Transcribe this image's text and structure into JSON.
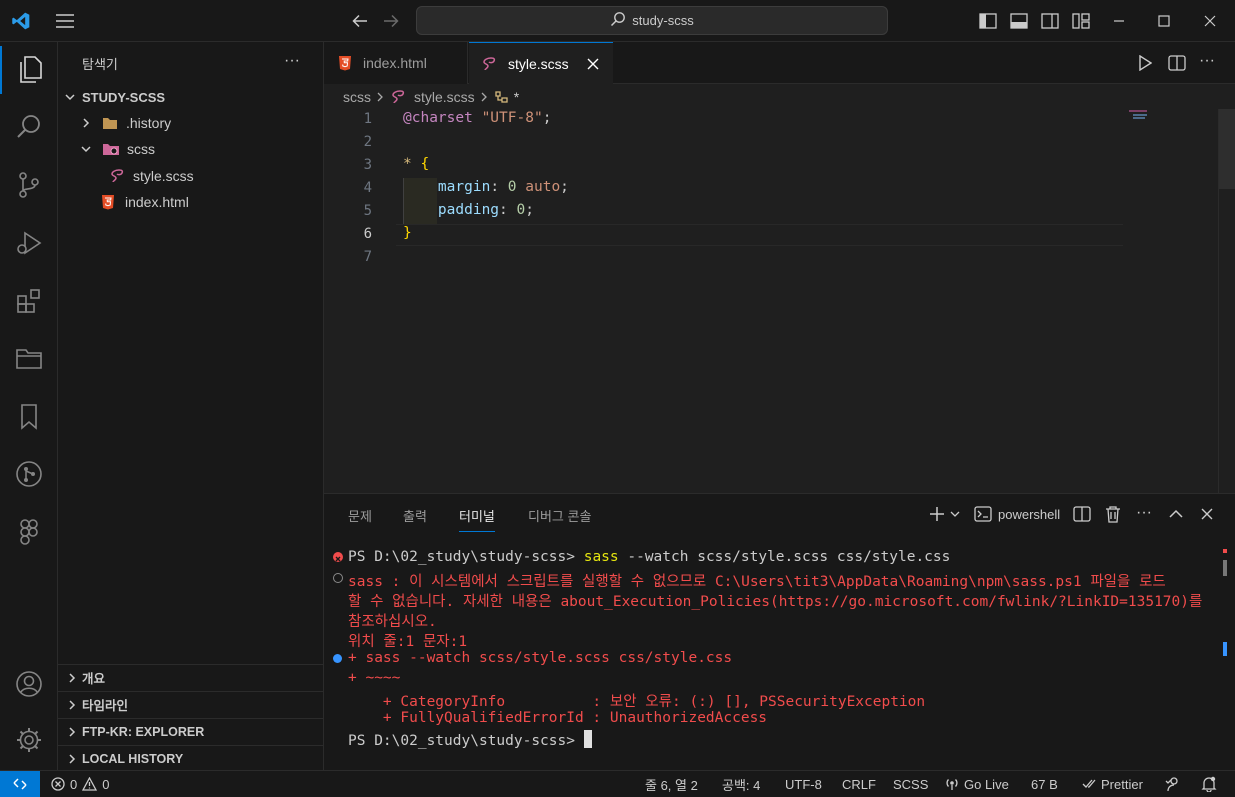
{
  "titlebar": {
    "search_text": "study-scss"
  },
  "sidebar": {
    "title": "탐색기",
    "more": "···",
    "root": "STUDY-SCSS",
    "items": [
      {
        "label": ".history"
      },
      {
        "label": "scss"
      },
      {
        "label": "style.scss"
      },
      {
        "label": "index.html"
      }
    ],
    "sections": [
      {
        "label": "개요"
      },
      {
        "label": "타임라인"
      },
      {
        "label": "FTP-KR: EXPLORER"
      },
      {
        "label": "LOCAL HISTORY"
      }
    ]
  },
  "tabs": [
    {
      "label": "index.html"
    },
    {
      "label": "style.scss"
    }
  ],
  "breadcrumb": {
    "folder": "scss",
    "file": "style.scss",
    "symbol": "*"
  },
  "editor": {
    "line_numbers": [
      "1",
      "2",
      "3",
      "4",
      "5",
      "6",
      "7"
    ],
    "line1": {
      "at": "@charset",
      "str": "\"UTF-8\"",
      "semi": ";"
    },
    "line3": {
      "sel": "*",
      "brace": "{"
    },
    "line4": {
      "prop": "margin",
      "colon": ":",
      "num": "0",
      "kw": "auto",
      "semi": ";"
    },
    "line5": {
      "prop": "padding",
      "colon": ":",
      "num": "0",
      "semi": ";"
    },
    "line6": {
      "brace": "}"
    }
  },
  "panel": {
    "tabs": [
      {
        "label": "문제"
      },
      {
        "label": "출력"
      },
      {
        "label": "터미널"
      },
      {
        "label": "디버그 콘솔"
      }
    ],
    "shell_label": "powershell",
    "terminal": {
      "prompt1": "PS D:\\02_study\\study-scss>",
      "cmd": "sass",
      "cmd_args": " --watch scss/style.scss css/style.css",
      "err1": "sass : 이 시스템에서 스크립트를 실행할 수 없으므로 C:\\Users\\tit3\\AppData\\Roaming\\npm\\sass.ps1 파일을 로드",
      "err2": "할 수 없습니다. 자세한 내용은 about_Execution_Policies(https://go.microsoft.com/fwlink/?LinkID=135170)를",
      "err3": "참조하십시오.",
      "err4": "위치 줄:1 문자:1",
      "err5": "+ sass --watch scss/style.scss css/style.css",
      "err6": "+ ~~~~",
      "err7": "    + CategoryInfo          : 보안 오류: (:) [], PSSecurityException",
      "err8": "    + FullyQualifiedErrorId : UnauthorizedAccess",
      "prompt2": "PS D:\\02_study\\study-scss>"
    }
  },
  "status": {
    "errors": "0",
    "warnings": "0",
    "position": "줄 6, 열 2",
    "spaces": "공백: 4",
    "encoding": "UTF-8",
    "eol": "CRLF",
    "language": "SCSS",
    "golive": "Go Live",
    "size": "67 B",
    "prettier": "Prettier"
  },
  "colors": {
    "accent": "#0078d4",
    "error": "#f14c4c",
    "html_icon": "#e44d26",
    "sass_icon": "#cd6799",
    "folder": "#c09553"
  }
}
